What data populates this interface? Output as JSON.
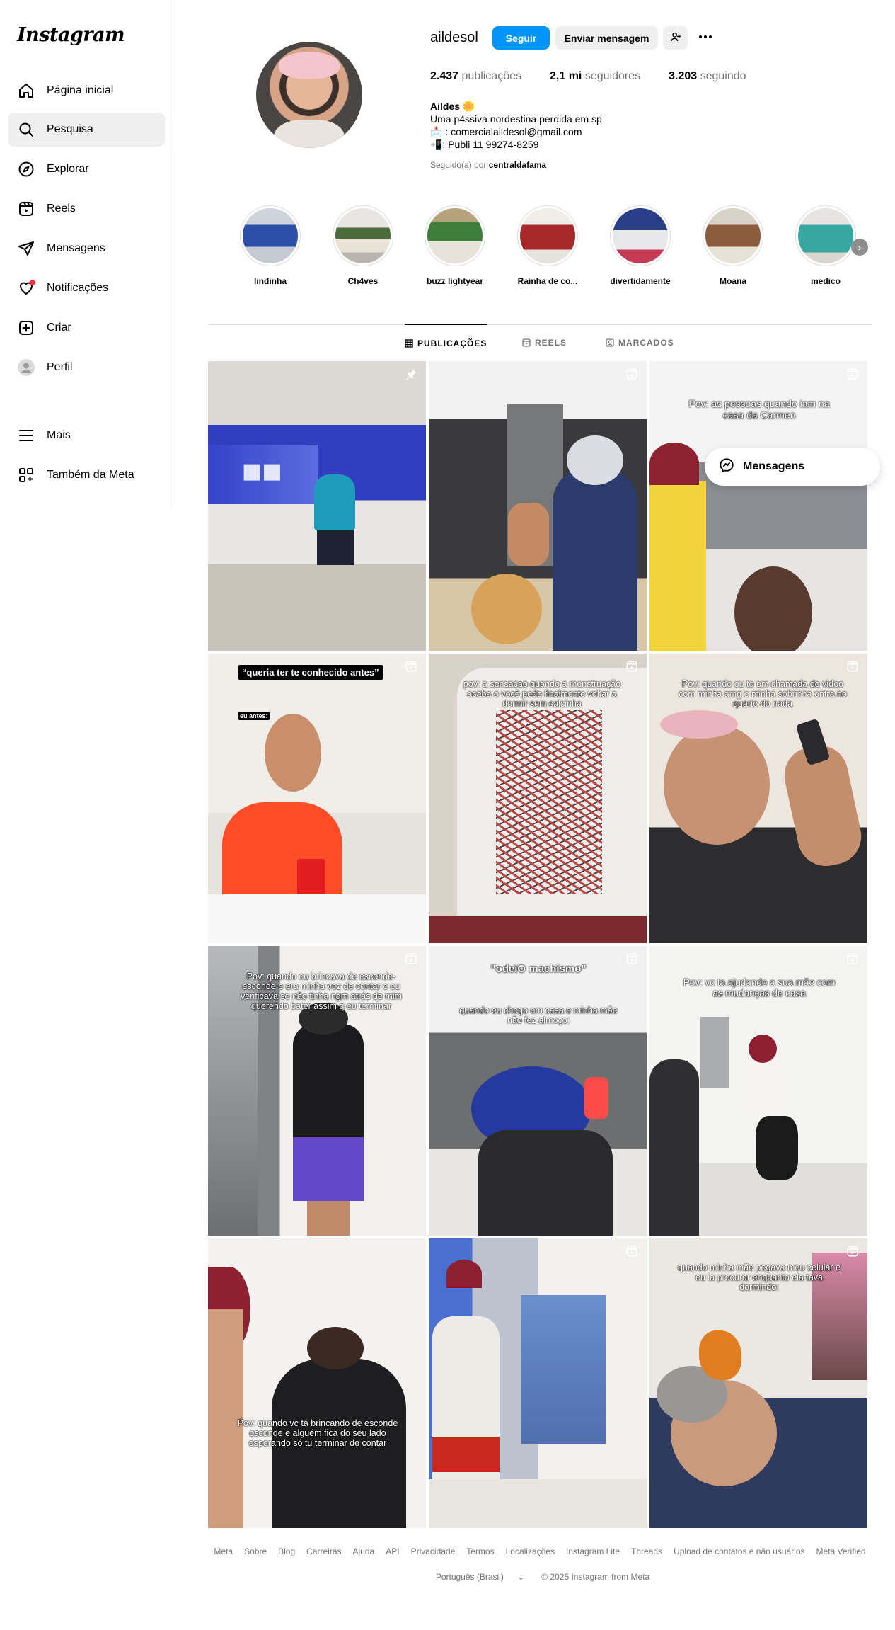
{
  "app": {
    "logo": "Instagram"
  },
  "sidebar": {
    "items": [
      {
        "label": "Página inicial",
        "icon": "home-icon"
      },
      {
        "label": "Pesquisa",
        "icon": "search-icon"
      },
      {
        "label": "Explorar",
        "icon": "compass-icon"
      },
      {
        "label": "Reels",
        "icon": "reels-icon"
      },
      {
        "label": "Mensagens",
        "icon": "send-icon"
      },
      {
        "label": "Notificações",
        "icon": "heart-icon"
      },
      {
        "label": "Criar",
        "icon": "plus-square-icon"
      },
      {
        "label": "Perfil",
        "icon": "profile-avatar-icon"
      },
      {
        "label": "Mais",
        "icon": "menu-icon"
      },
      {
        "label": "Também da Meta",
        "icon": "meta-apps-icon"
      }
    ],
    "active": "Pesquisa"
  },
  "profile": {
    "username": "aildesol",
    "follow_label": "Seguir",
    "message_label": "Enviar mensagem",
    "stats": {
      "posts_value": "2.437",
      "posts_label": "publicações",
      "followers_value": "2,1 mi",
      "followers_label": "seguidores",
      "following_value": "3.203",
      "following_label": "seguindo"
    },
    "bio": {
      "name": "Aildes 🌼",
      "line1": "Uma p4ssiva nordestina perdida em sp",
      "line2": "📩 : comercialaildesol@gmail.com",
      "line3": "📲: Publi 11 99274-8259"
    },
    "followed_by_prefix": "Seguido(a) por",
    "followed_by_user": "centraldafama"
  },
  "highlights": [
    {
      "label": "lindinha"
    },
    {
      "label": "Ch4ves"
    },
    {
      "label": "buzz lightyear"
    },
    {
      "label": "Rainha de co..."
    },
    {
      "label": "divertidamente"
    },
    {
      "label": "Moana"
    },
    {
      "label": "medico"
    }
  ],
  "tabs": [
    {
      "label": "PUBLICAÇÕES",
      "active": true
    },
    {
      "label": "REELS",
      "active": false
    },
    {
      "label": "MARCADOS",
      "active": false
    }
  ],
  "posts": {
    "p3": {
      "text": "Pov: as pessoas quando iam na casa da Carmen"
    },
    "p4": {
      "box": "“queria ter te conhecido antes”",
      "small": "eu antes:"
    },
    "p5": {
      "text": "pov: a sensacao quando a menstruação acaba e você pode finalmente voltar a dormir sem calcinha"
    },
    "p6": {
      "text": "Pov: quando eu to em chamada de video com minha amg e minha sobrinha entra no quarto do nada"
    },
    "p7": {
      "text": "Pov: quando eu brincava de esconde-esconde e era minha vez de contar e eu verificava se não tinha ngm atrás de mim querendo bater assim q eu terminar"
    },
    "p8": {
      "title": "\"odeiO machismo\"",
      "text": "quando eu chego em casa e minha mãe não fez almoço:"
    },
    "p9": {
      "text": "Pov: vc ta ajudando a sua mãe com as mudanças de casa"
    },
    "p10": {
      "text": "Pov: quando vc tá brincando de esconde esconde e alguém fica do seu lado esperando só tu terminar de contar"
    },
    "p12": {
      "text": "quando minha mãe pegava meu celular e eu ia procurar enquanto ela tava dormindo:"
    }
  },
  "messages_pill": {
    "label": "Mensagens"
  },
  "footer": {
    "links": [
      "Meta",
      "Sobre",
      "Blog",
      "Carreiras",
      "Ajuda",
      "API",
      "Privacidade",
      "Termos",
      "Localizações",
      "Instagram Lite",
      "Threads",
      "Upload de contatos e não usuários",
      "Meta Verified"
    ],
    "language": "Português (Brasil)",
    "copyright": "© 2025 Instagram from Meta"
  },
  "colors": {
    "accent": "#0095f6",
    "notification": "#ff3040",
    "muted": "#737373",
    "border": "#dbdbdb"
  }
}
